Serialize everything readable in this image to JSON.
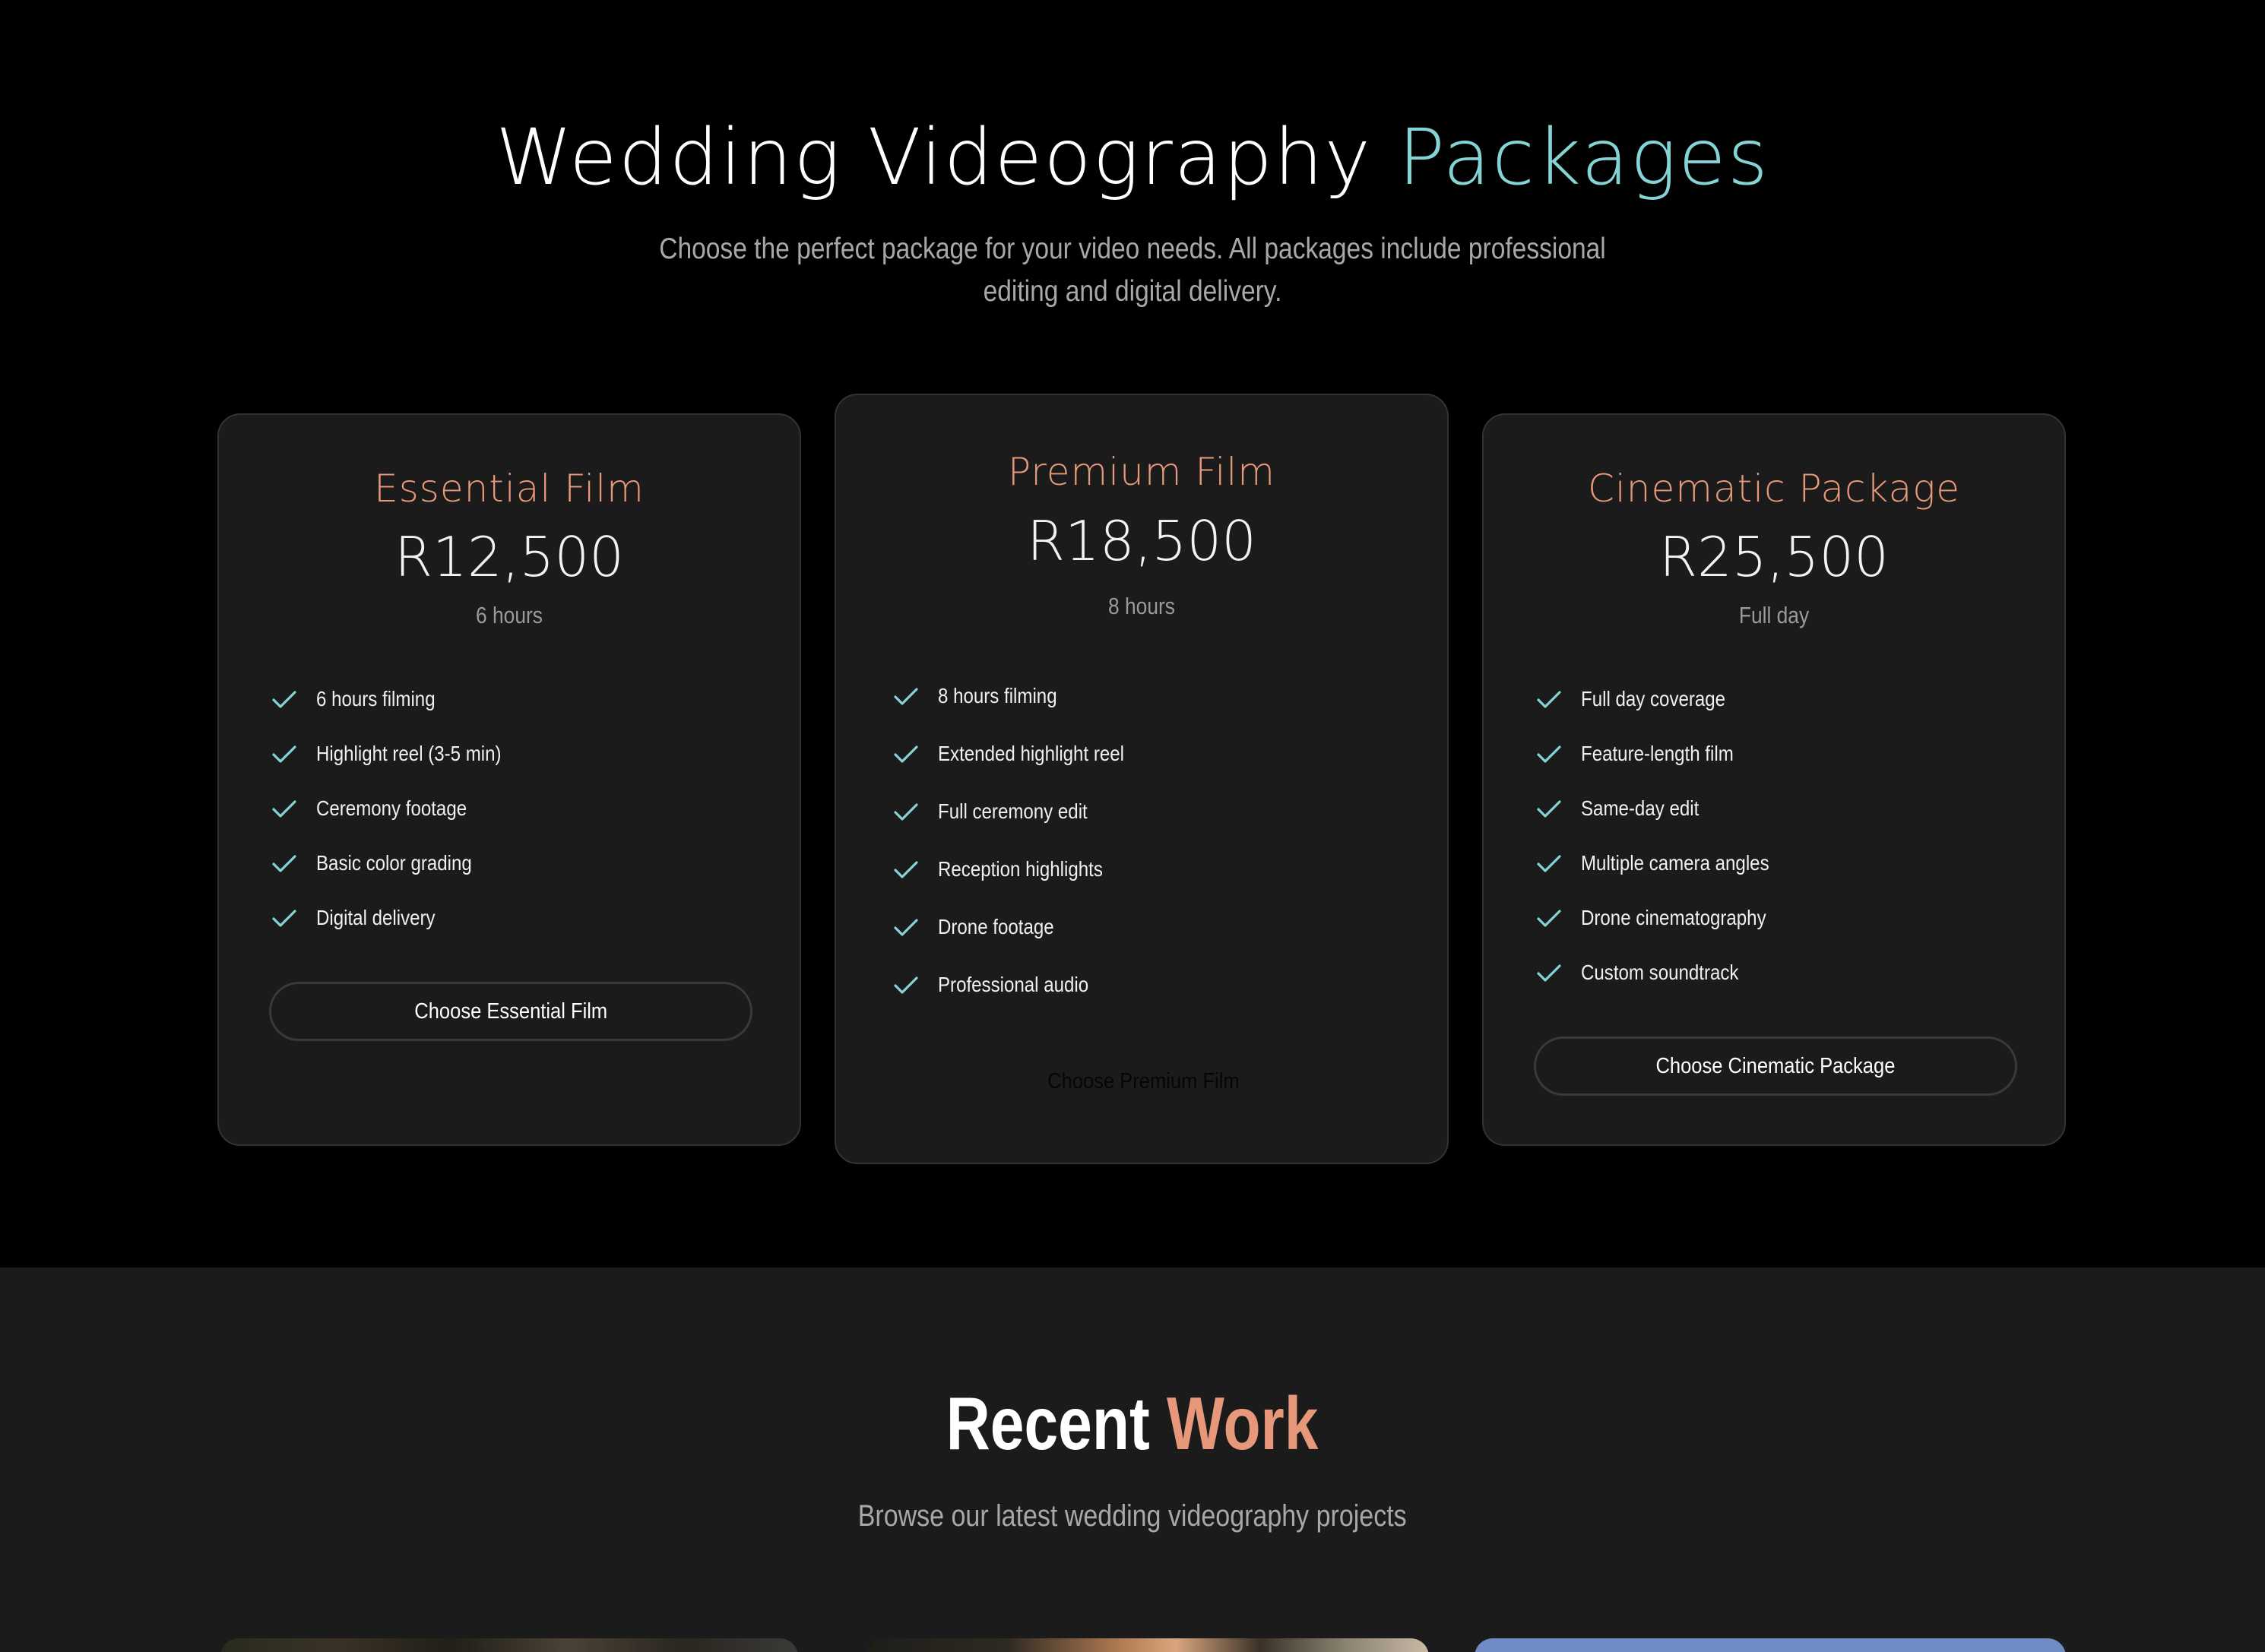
{
  "packages_section": {
    "title_main": "Wedding Videography",
    "title_accent": "Packages",
    "subtitle": "Choose the perfect package for your video needs. All packages include professional editing and digital delivery."
  },
  "cards": [
    {
      "name": "Essential Film",
      "price": "R12,500",
      "duration": "6 hours",
      "features": [
        "6 hours filming",
        "Highlight reel (3-5 min)",
        "Ceremony footage",
        "Basic color grading",
        "Digital delivery"
      ],
      "button_label": "Choose Essential Film"
    },
    {
      "name": "Premium Film",
      "price": "R18,500",
      "duration": "8 hours",
      "features": [
        "8 hours filming",
        "Extended highlight reel",
        "Full ceremony edit",
        "Reception highlights",
        "Drone footage",
        "Professional audio"
      ],
      "button_label": "Choose Premium Film"
    },
    {
      "name": "Cinematic Package",
      "price": "R25,500",
      "duration": "Full day",
      "features": [
        "Full day coverage",
        "Feature-length film",
        "Same-day edit",
        "Multiple camera angles",
        "Drone cinematography",
        "Custom soundtrack"
      ],
      "button_label": "Choose Cinematic Package"
    }
  ],
  "recent_work": {
    "title_main": "Recent",
    "title_accent": "Work",
    "subtitle": "Browse our latest wedding videography projects"
  },
  "icons": {
    "feature_check": "check-icon"
  },
  "colors": {
    "accent_teal": "#86d3d6",
    "accent_peach": "#e8987a",
    "card_bg": "#1b1b1b",
    "page_bg": "#000000"
  }
}
